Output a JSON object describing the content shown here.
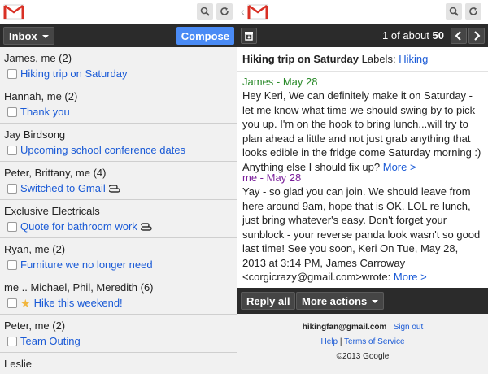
{
  "left": {
    "inbox_label": "Inbox",
    "compose_label": "Compose",
    "threads": [
      {
        "participants": "James, me (2)",
        "subject": "Hiking trip on Saturday",
        "starred": false,
        "attachment": false
      },
      {
        "participants": "Hannah, me (2)",
        "subject": "Thank you",
        "starred": false,
        "attachment": false
      },
      {
        "participants": "Jay Birdsong",
        "subject": "Upcoming school conference dates",
        "starred": false,
        "attachment": false
      },
      {
        "participants": "Peter, Brittany, me (4)",
        "subject": "Switched to Gmail",
        "starred": false,
        "attachment": true
      },
      {
        "participants": "Exclusive Electricals",
        "subject": "Quote for bathroom work",
        "starred": false,
        "attachment": true
      },
      {
        "participants": "Ryan, me (2)",
        "subject": "Furniture we no longer need",
        "starred": false,
        "attachment": false
      },
      {
        "participants": "me .. Michael, Phil, Meredith (6)",
        "subject": "Hike this weekend!",
        "starred": true,
        "attachment": false
      },
      {
        "participants": "Peter, me (2)",
        "subject": "Team Outing",
        "starred": false,
        "attachment": false
      },
      {
        "participants": "Leslie",
        "subject": "",
        "starred": false,
        "attachment": false
      }
    ]
  },
  "right": {
    "count_range": "1",
    "count_of": "of about",
    "count_total": "50",
    "subject": "Hiking trip on Saturday",
    "labels_prefix": "Labels:",
    "label": "Hiking",
    "messages": [
      {
        "sender_date": "James - May 28",
        "sender_color": "#2a8a2a",
        "body": "Hey Keri, We can definitely make it on Saturday - let me know what time we should swing by to pick you up. I'm on the hook to bring lunch...will try to plan ahead a little and not just grab anything that looks edible in the fridge come Saturday morning :) Anything else I should fix up?",
        "more": "More >"
      },
      {
        "sender_date": "me - May 28",
        "sender_color": "#7a1f9a",
        "body": "Yay - so glad you can join. We should leave from here around 9am, hope that is OK. LOL re lunch, just bring whatever's easy. Don't forget your sunblock - your reverse panda look wasn't so good last time! See you soon, Keri On Tue, May 28, 2013 at 3:14 PM, James Carroway <corgicrazy@gmail.com>wrote:",
        "more": "More >"
      }
    ],
    "reply_all_label": "Reply all",
    "more_actions_label": "More actions",
    "footer": {
      "account": "hikingfan@gmail.com",
      "sep1": "|",
      "sign_out": "Sign out",
      "help": "Help",
      "sep2": "|",
      "terms": "Terms of Service",
      "copyright": "©2013 Google"
    }
  },
  "icons": {
    "logo": "gmail-logo",
    "search": "search-icon",
    "refresh": "refresh-icon",
    "archive": "archive-icon",
    "prev": "chevron-left-icon",
    "next": "chevron-right-icon",
    "back": "back-arrow-icon",
    "attachment": "paperclip-icon",
    "star": "star-icon"
  },
  "colors": {
    "link": "#1a5ad6",
    "compose": "#4a8bf5",
    "toolbar": "#2b2b2b",
    "pane_bg": "#f1f1f1"
  }
}
